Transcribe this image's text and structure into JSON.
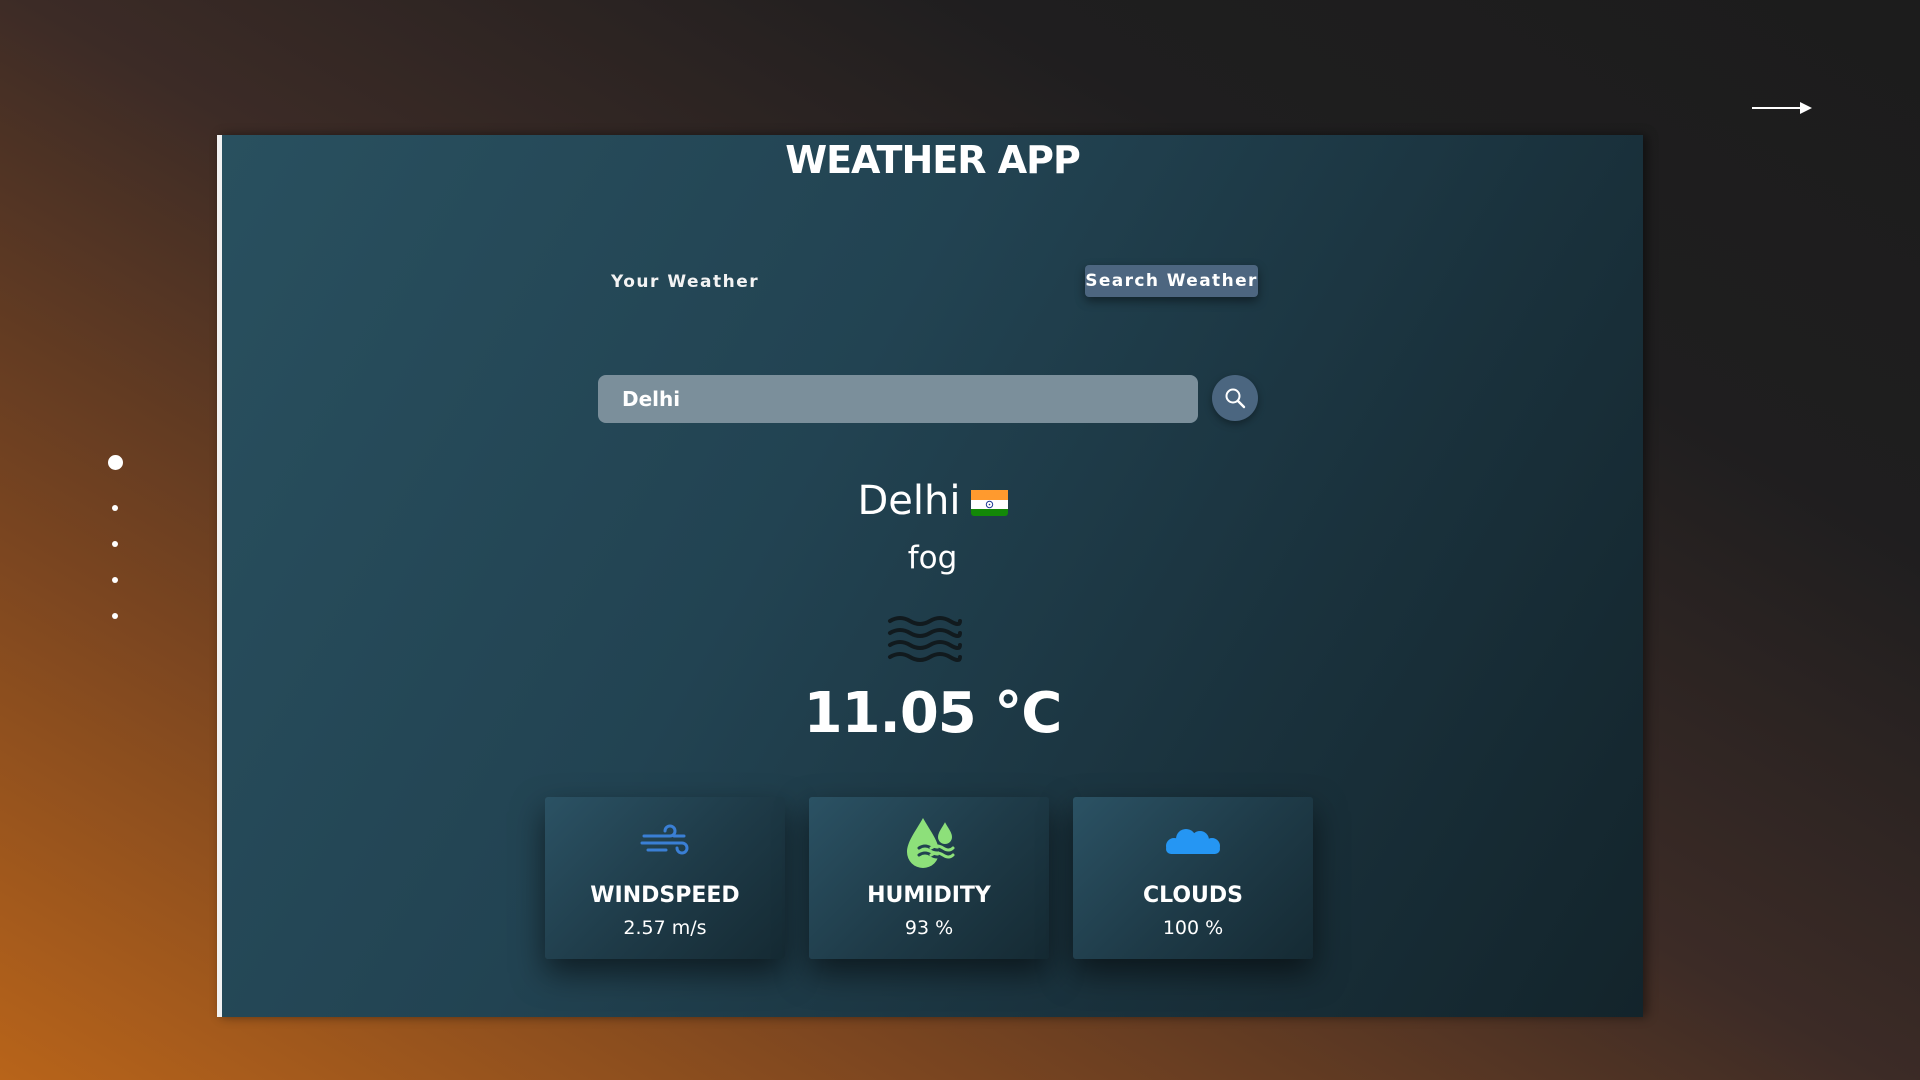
{
  "colors": {
    "frame_bg": "#224352",
    "search_button": "#4b6680",
    "input_bg": "#7b8f9b",
    "wind_icon": "#3a7fd5",
    "humidity_icon": "#8de07a",
    "clouds_icon": "#2596f3"
  },
  "nav": {
    "next_icon": "arrow-right-icon",
    "slides": 5,
    "active_slide": 1
  },
  "app": {
    "title": "WEATHER APP",
    "tabs": [
      {
        "label": "Your Weather",
        "active": false
      },
      {
        "label": "Search Weather",
        "active": true
      }
    ]
  },
  "search": {
    "value": "Delhi",
    "button_icon": "search-icon"
  },
  "weather": {
    "city": "Delhi",
    "flag_icon": "india-flag-icon",
    "condition": "fog",
    "condition_icon": "fog-icon",
    "temperature": "11.05 °C"
  },
  "stats": [
    {
      "icon": "wind-icon",
      "title": "WINDSPEED",
      "value": "2.57 m/s"
    },
    {
      "icon": "humidity-icon",
      "title": "HUMIDITY",
      "value": "93 %"
    },
    {
      "icon": "clouds-icon",
      "title": "CLOUDS",
      "value": "100 %"
    }
  ]
}
